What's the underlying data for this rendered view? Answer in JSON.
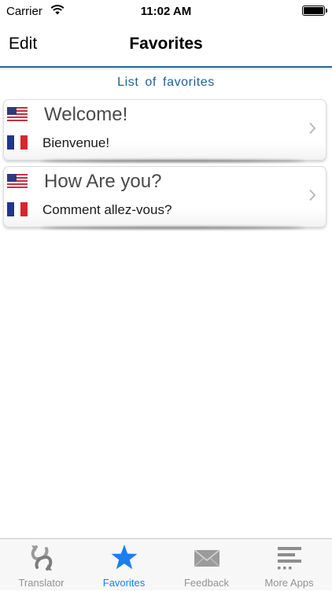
{
  "status_bar": {
    "carrier": "Carrier",
    "time": "11:02 AM"
  },
  "nav": {
    "left_button": "Edit",
    "title": "Favorites"
  },
  "section_header": "List of favorites",
  "favorites": [
    {
      "source_flag": "us-flag-icon",
      "source_text": "Welcome!",
      "target_flag": "france-flag-icon",
      "target_text": "Bienvenue!"
    },
    {
      "source_flag": "us-flag-icon",
      "source_text": "How Are you?",
      "target_flag": "france-flag-icon",
      "target_text": "Comment allez-vous?"
    }
  ],
  "tabs": [
    {
      "label": "Translator",
      "icon": "translate-arrows-icon",
      "active": false
    },
    {
      "label": "Favorites",
      "icon": "star-icon",
      "active": true
    },
    {
      "label": "Feedback",
      "icon": "envelope-icon",
      "active": false
    },
    {
      "label": "More Apps",
      "icon": "list-icon",
      "active": false
    }
  ],
  "colors": {
    "accent": "#1a7ff0",
    "header_text": "#1f5f95",
    "nav_rule": "#2c6a8f",
    "tab_inactive": "#929292"
  }
}
